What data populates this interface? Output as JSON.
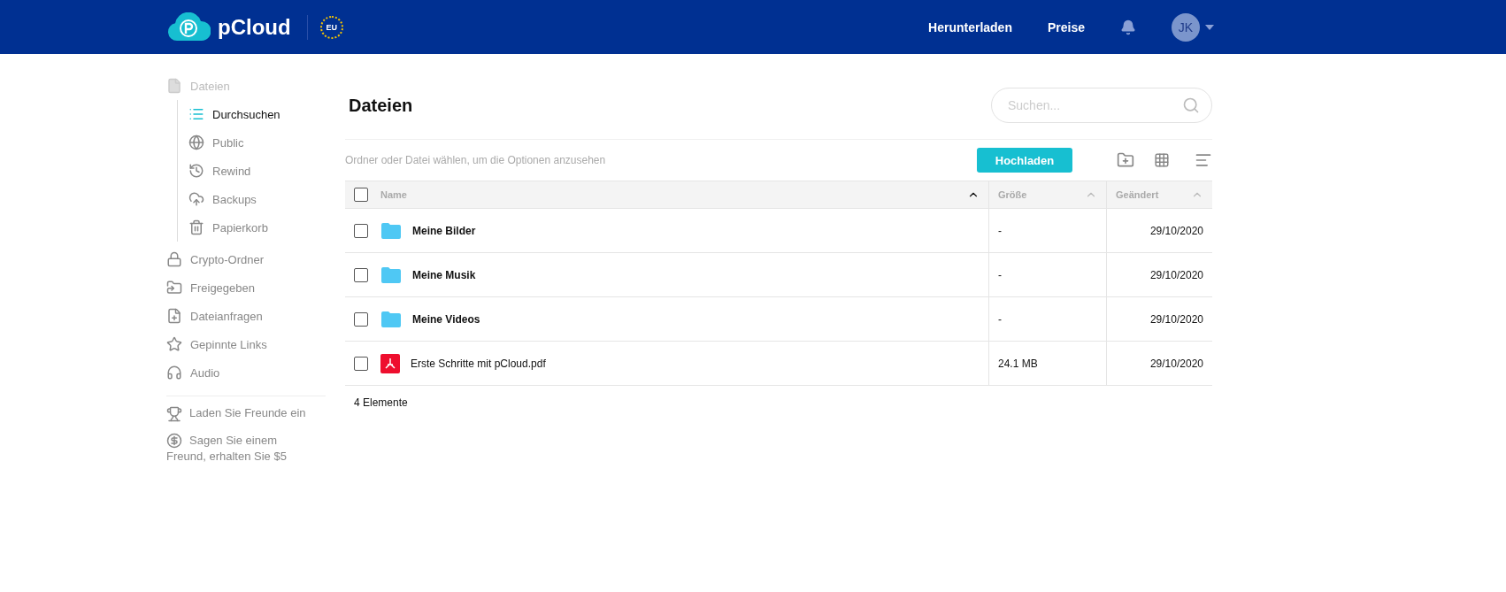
{
  "header": {
    "brand": "pCloud",
    "region": "EU",
    "links": [
      "Herunterladen",
      "Preise"
    ],
    "avatar": "JK"
  },
  "sidebar": {
    "root": {
      "label": "Dateien",
      "disabled": true,
      "children": [
        {
          "label": "Durchsuchen",
          "selected": true
        },
        {
          "label": "Public",
          "selected": false
        },
        {
          "label": "Rewind",
          "selected": false
        },
        {
          "label": "Backups",
          "selected": false
        },
        {
          "label": "Papierkorb",
          "selected": false
        }
      ]
    },
    "items": [
      "Crypto-Ordner",
      "Freigegeben",
      "Dateianfragen",
      "Gepinnte Links",
      "Audio"
    ],
    "extras": [
      "Laden Sie Freunde ein",
      "Sagen Sie einem Freund, erhalten Sie $5"
    ]
  },
  "main": {
    "title": "Dateien",
    "search": {
      "placeholder": "Suchen..."
    },
    "hint": "Ordner oder Datei wählen, um die Optionen anzusehen",
    "upload": "Hochladen",
    "table": {
      "select_all": false,
      "columns": [
        {
          "label": "Name",
          "sorted": true
        },
        {
          "label": "Größe",
          "sorted": false
        },
        {
          "label": "Geändert",
          "sorted": false
        }
      ],
      "rows": [
        {
          "kind": "folder",
          "name": "Meine Bilder",
          "size": "-",
          "modified": "29/10/2020",
          "selected": false
        },
        {
          "kind": "folder",
          "name": "Meine Musik",
          "size": "-",
          "modified": "29/10/2020",
          "selected": false
        },
        {
          "kind": "folder",
          "name": "Meine Videos",
          "size": "-",
          "modified": "29/10/2020",
          "selected": false
        },
        {
          "kind": "pdf",
          "name": "Erste Schritte mit pCloud.pdf",
          "size": "24.1 MB",
          "modified": "29/10/2020",
          "selected": false
        }
      ]
    },
    "count": "4 Elemente"
  }
}
